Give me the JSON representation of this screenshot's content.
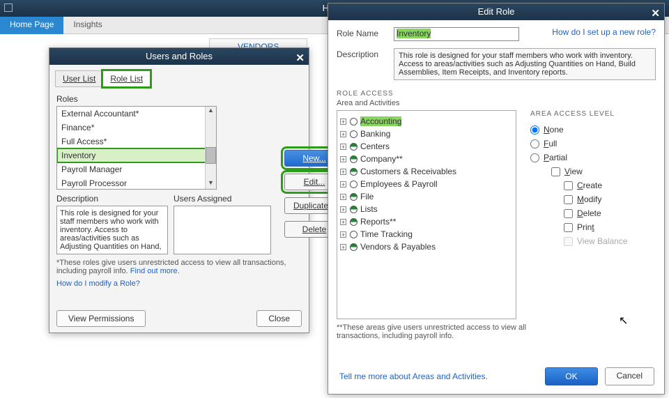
{
  "home": {
    "title": "Home",
    "tabs": [
      "Home Page",
      "Insights"
    ],
    "vendors": "VENDORS"
  },
  "usersDlg": {
    "title": "Users and Roles",
    "tabs": {
      "user": "User List",
      "role": "Role List"
    },
    "rolesLabel": "Roles",
    "roles": [
      "External Accountant*",
      "Finance*",
      "Full Access*",
      "Inventory",
      "Payroll Manager",
      "Payroll Processor"
    ],
    "btns": {
      "new": "New...",
      "edit": "Edit...",
      "dup": "Duplicate...",
      "del": "Delete"
    },
    "descLabel": "Description",
    "usersAssignedLabel": "Users Assigned",
    "desc": "This role is designed for your staff members who work with inventory. Access to areas/activities such as Adjusting Quantities on Hand,",
    "footnote": "*These roles give users unrestricted access to view all transactions, including payroll info.",
    "findOut": "Find out more.",
    "modifyLink": "How do I modify a Role?",
    "viewPerm": "View Permissions",
    "close": "Close"
  },
  "editDlg": {
    "title": "Edit Role",
    "setupLink": "How do I set up a new role?",
    "roleNameLabel": "Role Name",
    "roleName": "Inventory",
    "descLabel": "Description",
    "desc": "This role is designed for your staff members who work with inventory. Access to areas/activities such as Adjusting Quantities on Hand, Build Assemblies, Item Receipts, and Inventory reports.",
    "roleAccess": "ROLE ACCESS",
    "areaLabel": "Area and Activities",
    "tree": [
      {
        "label": "Accounting",
        "fill": "none",
        "sel": true
      },
      {
        "label": "Banking",
        "fill": "none"
      },
      {
        "label": "Centers",
        "fill": "half"
      },
      {
        "label": "Company**",
        "fill": "half"
      },
      {
        "label": "Customers & Receivables",
        "fill": "half"
      },
      {
        "label": "Employees & Payroll",
        "fill": "none"
      },
      {
        "label": "File",
        "fill": "half"
      },
      {
        "label": "Lists",
        "fill": "half"
      },
      {
        "label": "Reports**",
        "fill": "half"
      },
      {
        "label": "Time Tracking",
        "fill": "none"
      },
      {
        "label": "Vendors & Payables",
        "fill": "half"
      }
    ],
    "accessHeader": "AREA ACCESS LEVEL",
    "levels": {
      "none": "None",
      "full": "Full",
      "partial": "Partial"
    },
    "perms": {
      "view": "View",
      "create": "Create",
      "modify": "Modify",
      "delete": "Delete",
      "print": "Print",
      "viewbal": "View Balance"
    },
    "note": "**These areas give users unrestricted access to view all transactions, including payroll info.",
    "tellMore": "Tell me more about Areas and Activities.",
    "ok": "OK",
    "cancel": "Cancel"
  }
}
